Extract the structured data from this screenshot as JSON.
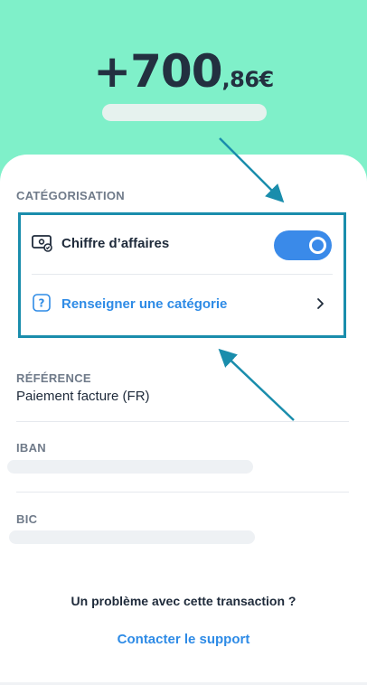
{
  "header": {
    "amount_main": "+700",
    "amount_cents": ",86€"
  },
  "categorisation": {
    "section_label": "CATÉGORISATION",
    "revenue_label": "Chiffre d’affaires",
    "revenue_toggle_on": true,
    "category_link": "Renseigner une catégorie"
  },
  "reference": {
    "label": "RÉFÉRENCE",
    "value": "Paiement facture (FR)"
  },
  "iban": {
    "label": "IBAN"
  },
  "bic": {
    "label": "BIC"
  },
  "footer": {
    "problem_text": "Un problème avec cette transaction ?",
    "support_link": "Contacter le support"
  },
  "colors": {
    "header_bg": "#7ff0c9",
    "accent_blue": "#2e8be6",
    "toggle_on": "#3a8ae9",
    "highlight_border": "#1a8dac",
    "text_dark": "#1e2a3a",
    "label_gray": "#6f7a89"
  },
  "icons": {
    "revenue": "money-bill-icon",
    "help": "question-mark-icon",
    "chevron": "chevron-right-icon"
  }
}
